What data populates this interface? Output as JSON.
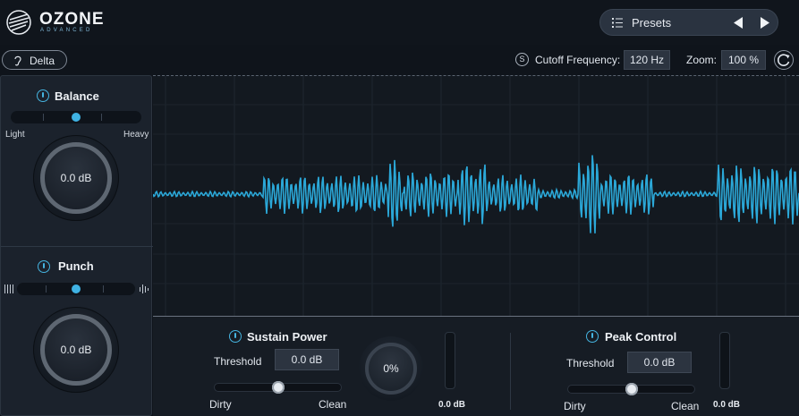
{
  "app": {
    "logo_text": "OZONE",
    "logo_sub": "ADVANCED"
  },
  "presets": {
    "label": "Presets",
    "prev_icon": "triangle-left-icon",
    "next_icon": "triangle-right-icon"
  },
  "toolbar": {
    "delta_label": "Delta",
    "solo_icon_label": "S",
    "cutoff_label": "Cutoff Frequency:",
    "cutoff_value": "120 Hz",
    "zoom_label": "Zoom:",
    "zoom_value": "100 %"
  },
  "balance": {
    "title": "Balance",
    "left_label": "Light",
    "right_label": "Heavy",
    "knob_value": "0.0 dB",
    "slider_position": 0.5
  },
  "punch": {
    "title": "Punch",
    "knob_value": "0.0 dB",
    "slider_position": 0.5
  },
  "sustain_power": {
    "title": "Sustain Power",
    "threshold_label": "Threshold",
    "threshold_value": "0.0 dB",
    "left_label": "Dirty",
    "right_label": "Clean",
    "slider_position": 0.5,
    "amount_value": "0%",
    "meter_value": "0.0 dB"
  },
  "peak_control": {
    "title": "Peak Control",
    "threshold_label": "Threshold",
    "threshold_value": "0.0 dB",
    "left_label": "Dirty",
    "right_label": "Clean",
    "slider_position": 0.5,
    "meter_value": "0.0 dB"
  },
  "colors": {
    "accent": "#3fb2e3",
    "waveform": "#2ba8d8",
    "background": "#0f141b"
  }
}
